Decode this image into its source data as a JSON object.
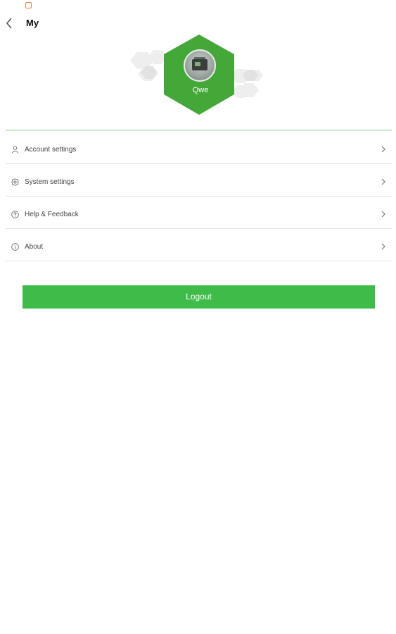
{
  "header": {
    "title": "My",
    "back_icon": "chevron-left-icon"
  },
  "profile": {
    "username": "Qwe",
    "avatar": "machine-photo"
  },
  "colors": {
    "accent": "#3fbb4a",
    "hexagon": "#43a838",
    "divider": "#c9e8c9"
  },
  "menu": {
    "items": [
      {
        "label": "Account settings",
        "icon": "person-icon"
      },
      {
        "label": "System settings",
        "icon": "gear-icon"
      },
      {
        "label": "Help & Feedback",
        "icon": "help-icon"
      },
      {
        "label": "About",
        "icon": "info-icon"
      }
    ]
  },
  "logout": {
    "label": "Logout"
  }
}
